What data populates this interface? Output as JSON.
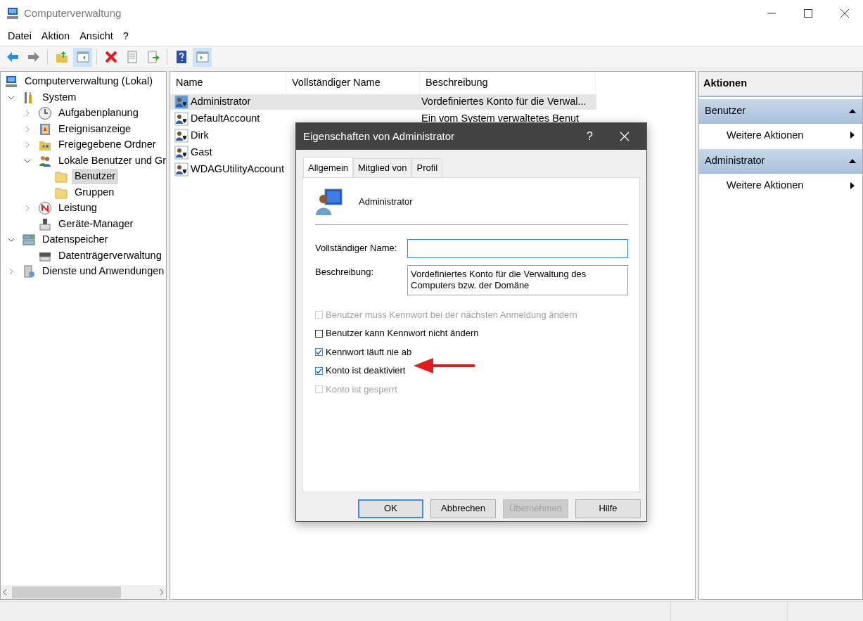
{
  "window": {
    "title": "Computerverwaltung"
  },
  "menu": [
    {
      "label": "Datei"
    },
    {
      "label": "Aktion"
    },
    {
      "label": "Ansicht"
    },
    {
      "label": "?"
    }
  ],
  "toolbar": [
    {
      "kind": "back",
      "selected": false
    },
    {
      "kind": "forward",
      "selected": false
    },
    {
      "kind": "separator"
    },
    {
      "kind": "up",
      "selected": false
    },
    {
      "kind": "tree",
      "selected": true
    },
    {
      "kind": "separator"
    },
    {
      "kind": "delete",
      "selected": false
    },
    {
      "kind": "properties",
      "selected": false
    },
    {
      "kind": "export",
      "selected": false
    },
    {
      "kind": "separator"
    },
    {
      "kind": "help",
      "selected": false
    },
    {
      "kind": "actionpane",
      "selected": true
    }
  ],
  "tree": [
    {
      "label": "Computerverwaltung (Lokal)",
      "kind": "computer",
      "selected": false,
      "children": [
        {
          "label": "System",
          "kind": "tools",
          "expanded": true,
          "selected": false,
          "children": [
            {
              "label": "Aufgabenplanung",
              "kind": "clock",
              "expanded": false,
              "selected": false
            },
            {
              "label": "Ereignisanzeige",
              "kind": "event",
              "expanded": false,
              "selected": false
            },
            {
              "label": "Freigegebene Ordner",
              "kind": "share",
              "expanded": false,
              "selected": false
            },
            {
              "label": "Lokale Benutzer und Gr",
              "kind": "users",
              "expanded": true,
              "selected": false,
              "children": [
                {
                  "label": "Benutzer",
                  "kind": "folder",
                  "selected": true
                },
                {
                  "label": "Gruppen",
                  "kind": "folder",
                  "selected": false
                }
              ]
            },
            {
              "label": "Leistung",
              "kind": "perf",
              "expanded": false,
              "selected": false
            },
            {
              "label": "Geräte-Manager",
              "kind": "device",
              "selected": false
            }
          ]
        },
        {
          "label": "Datenspeicher",
          "kind": "storage",
          "expanded": true,
          "selected": false,
          "children": [
            {
              "label": "Datenträgerverwaltung",
              "kind": "disk",
              "selected": false
            }
          ]
        },
        {
          "label": "Dienste und Anwendungen",
          "kind": "services",
          "expanded": false,
          "selected": false
        }
      ]
    }
  ],
  "list": {
    "columns": [
      "Name",
      "Vollständiger Name",
      "Beschreibung"
    ],
    "rows": [
      {
        "name": "Administrator",
        "description": "Vordefiniertes Konto für die Verwal...",
        "selected": true
      },
      {
        "name": "DefaultAccount",
        "description": "Ein vom System verwaltetes Benut",
        "selected": false
      },
      {
        "name": "Dirk",
        "selected": false
      },
      {
        "name": "Gast",
        "selected": false
      },
      {
        "name": "WDAGUtilityAccount",
        "selected": false
      }
    ]
  },
  "actions": {
    "title": "Aktionen",
    "sections": [
      {
        "title": "Benutzer",
        "items": [
          "Weitere Aktionen"
        ]
      },
      {
        "title": "Administrator",
        "items": [
          "Weitere Aktionen"
        ]
      }
    ]
  },
  "dialog": {
    "title": "Eigenschaften von Administrator",
    "help": "?",
    "tabs": [
      {
        "label": "Allgemein",
        "selected": true
      },
      {
        "label": "Mitglied von",
        "selected": false
      },
      {
        "label": "Profil",
        "selected": false
      }
    ],
    "user_name": "Administrator",
    "full_name": {
      "label": "Vollständiger Name:"
    },
    "description": {
      "label": "Beschreibung:",
      "value": "Vordefiniertes Konto für die Verwaltung des Computers bzw. der Domäne"
    },
    "checkboxes": [
      {
        "label": "Benutzer muss Kennwort bei der nächsten Anmeldung ändern",
        "checked": false,
        "disabled": true
      },
      {
        "label": "Benutzer kann Kennwort nicht ändern",
        "checked": false,
        "disabled": false
      },
      {
        "label": "Kennwort läuft nie ab",
        "checked": true,
        "disabled": false
      },
      {
        "label": "Konto ist deaktiviert",
        "checked": true,
        "disabled": false
      },
      {
        "label": "Konto ist gesperrt",
        "checked": false,
        "disabled": true
      }
    ],
    "buttons": [
      {
        "label": "OK",
        "default": true,
        "disabled": false
      },
      {
        "label": "Abbrechen",
        "default": false,
        "disabled": false
      },
      {
        "label": "Übernehmen",
        "default": false,
        "disabled": true
      },
      {
        "label": "Hilfe",
        "default": false,
        "disabled": false
      }
    ]
  }
}
